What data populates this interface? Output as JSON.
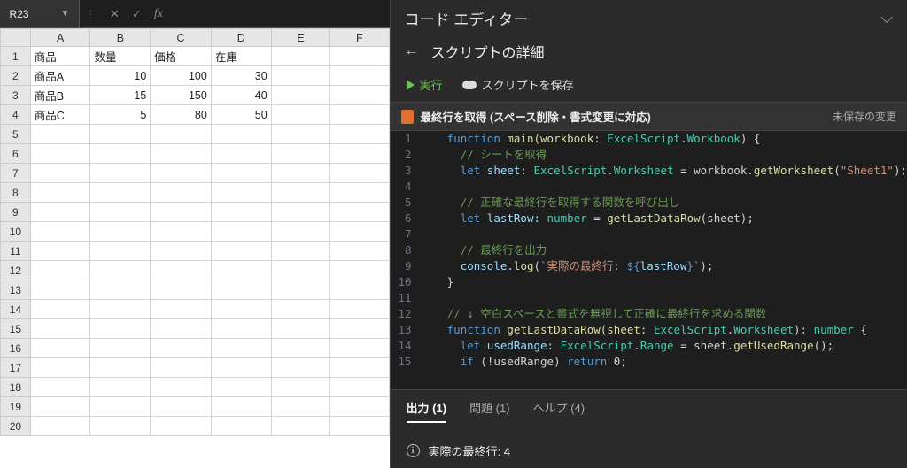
{
  "namebox": {
    "ref": "R23"
  },
  "sheet": {
    "columns": [
      "A",
      "B",
      "C",
      "D",
      "E",
      "F"
    ],
    "rowCount": 20,
    "headers": [
      "商品",
      "数量",
      "価格",
      "在庫"
    ],
    "rows": [
      {
        "name": "商品A",
        "qty": 10,
        "price": 100,
        "stock": 30
      },
      {
        "name": "商品B",
        "qty": 15,
        "price": 150,
        "stock": 40
      },
      {
        "name": "商品C",
        "qty": 5,
        "price": 80,
        "stock": 50
      }
    ]
  },
  "editor": {
    "panel_title": "コード エディター",
    "detail_title": "スクリプトの詳細",
    "run_label": "実行",
    "save_label": "スクリプトを保存",
    "script_name": "最終行を取得 (スペース削除・書式変更に対応)",
    "unsaved_label": "未保存の変更"
  },
  "code": {
    "l1_a": "function",
    "l1_b": " main(workbook: ",
    "l1_c": "ExcelScript",
    "l1_d": ".",
    "l1_e": "Workbook",
    "l1_f": ") {",
    "l2": "// シートを取得",
    "l3_a": "let",
    "l3_b": " sheet: ",
    "l3_c": "ExcelScript",
    "l3_d": ".",
    "l3_e": "Worksheet",
    "l3_f": " = workbook.",
    "l3_g": "getWorksheet",
    "l3_h": "(",
    "l3_i": "\"Sheet1\"",
    "l3_j": ");",
    "l5": "// 正確な最終行を取得する関数を呼び出し",
    "l6_a": "let",
    "l6_b": " lastRow: ",
    "l6_c": "number",
    "l6_d": " = ",
    "l6_e": "getLastDataRow",
    "l6_f": "(sheet);",
    "l8": "// 最終行を出力",
    "l9_a": "console.",
    "l9_b": "log",
    "l9_c": "(",
    "l9_d": "`実際の最終行: ",
    "l9_e": "${",
    "l9_f": "lastRow",
    "l9_g": "}",
    "l9_h": "`",
    "l9_i": ");",
    "l10": "}",
    "l12": "// ↓ 空白スペースと書式を無視して正確に最終行を求める関数",
    "l13_a": "function",
    "l13_b": " getLastDataRow(sheet: ",
    "l13_c": "ExcelScript",
    "l13_d": ".",
    "l13_e": "Worksheet",
    "l13_f": "): ",
    "l13_g": "number",
    "l13_h": " {",
    "l14_a": "let",
    "l14_b": " usedRange: ",
    "l14_c": "ExcelScript",
    "l14_d": ".",
    "l14_e": "Range",
    "l14_f": " = sheet.",
    "l14_g": "getUsedRange",
    "l14_h": "();",
    "l15_a": "if",
    "l15_b": " (!usedRange) ",
    "l15_c": "return",
    "l15_d": " 0;"
  },
  "tabs": {
    "output": "出力 (1)",
    "problems": "問題 (1)",
    "help": "ヘルプ (4)"
  },
  "console_output": "実際の最終行: 4"
}
